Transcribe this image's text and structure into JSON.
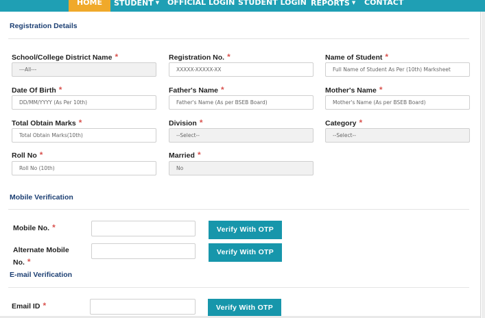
{
  "nav": {
    "items": [
      {
        "label": "HOME",
        "active": true
      },
      {
        "label": "STUDENT",
        "dropdown": true
      },
      {
        "label": "OFFICIAL LOGIN"
      },
      {
        "label": "STUDENT LOGIN"
      },
      {
        "label": "REPORTS",
        "dropdown": true
      },
      {
        "label": "CONTACT"
      }
    ],
    "caret": "▼",
    "colors": {
      "bar": "#1f9fb4",
      "active": "#f0a92a"
    }
  },
  "required_mark": "*",
  "registration": {
    "title": "Registration Details",
    "fields": {
      "district": {
        "label": "School/College District Name",
        "value": "---All---"
      },
      "reg_no": {
        "label": "Registration No.",
        "placeholder": "XXXXX-XXXXX-XX"
      },
      "student_name": {
        "label": "Name of Student",
        "placeholder": "Full Name of Student As Per (10th) Marksheet"
      },
      "dob": {
        "label": "Date Of Birth",
        "placeholder": "DD/MM/YYYY (As Per 10th)"
      },
      "father": {
        "label": "Father's Name",
        "placeholder": "Father's Name (As per BSEB Board)"
      },
      "mother": {
        "label": "Mother's Name",
        "placeholder": "Mother's Name (As per BSEB Board)"
      },
      "marks": {
        "label": "Total Obtain Marks",
        "placeholder": "Total Obtain Marks(10th)"
      },
      "division": {
        "label": "Division",
        "value": "--Select--"
      },
      "category": {
        "label": "Category",
        "value": "--Select--"
      },
      "roll": {
        "label": "Roll No",
        "placeholder": "Roll No (10th)"
      },
      "married": {
        "label": "Married",
        "value": "No"
      }
    }
  },
  "mobile": {
    "title": "Mobile Verification",
    "mobile_label": "Mobile No.",
    "alt_label_line1": "Alternate Mobile",
    "alt_label_line2": "No.",
    "verify_label": "Verify With OTP"
  },
  "email": {
    "title": "E-mail Verification",
    "email_label": "Email ID",
    "verify_label": "Verify With OTP"
  },
  "accent_color": "#1796ab"
}
